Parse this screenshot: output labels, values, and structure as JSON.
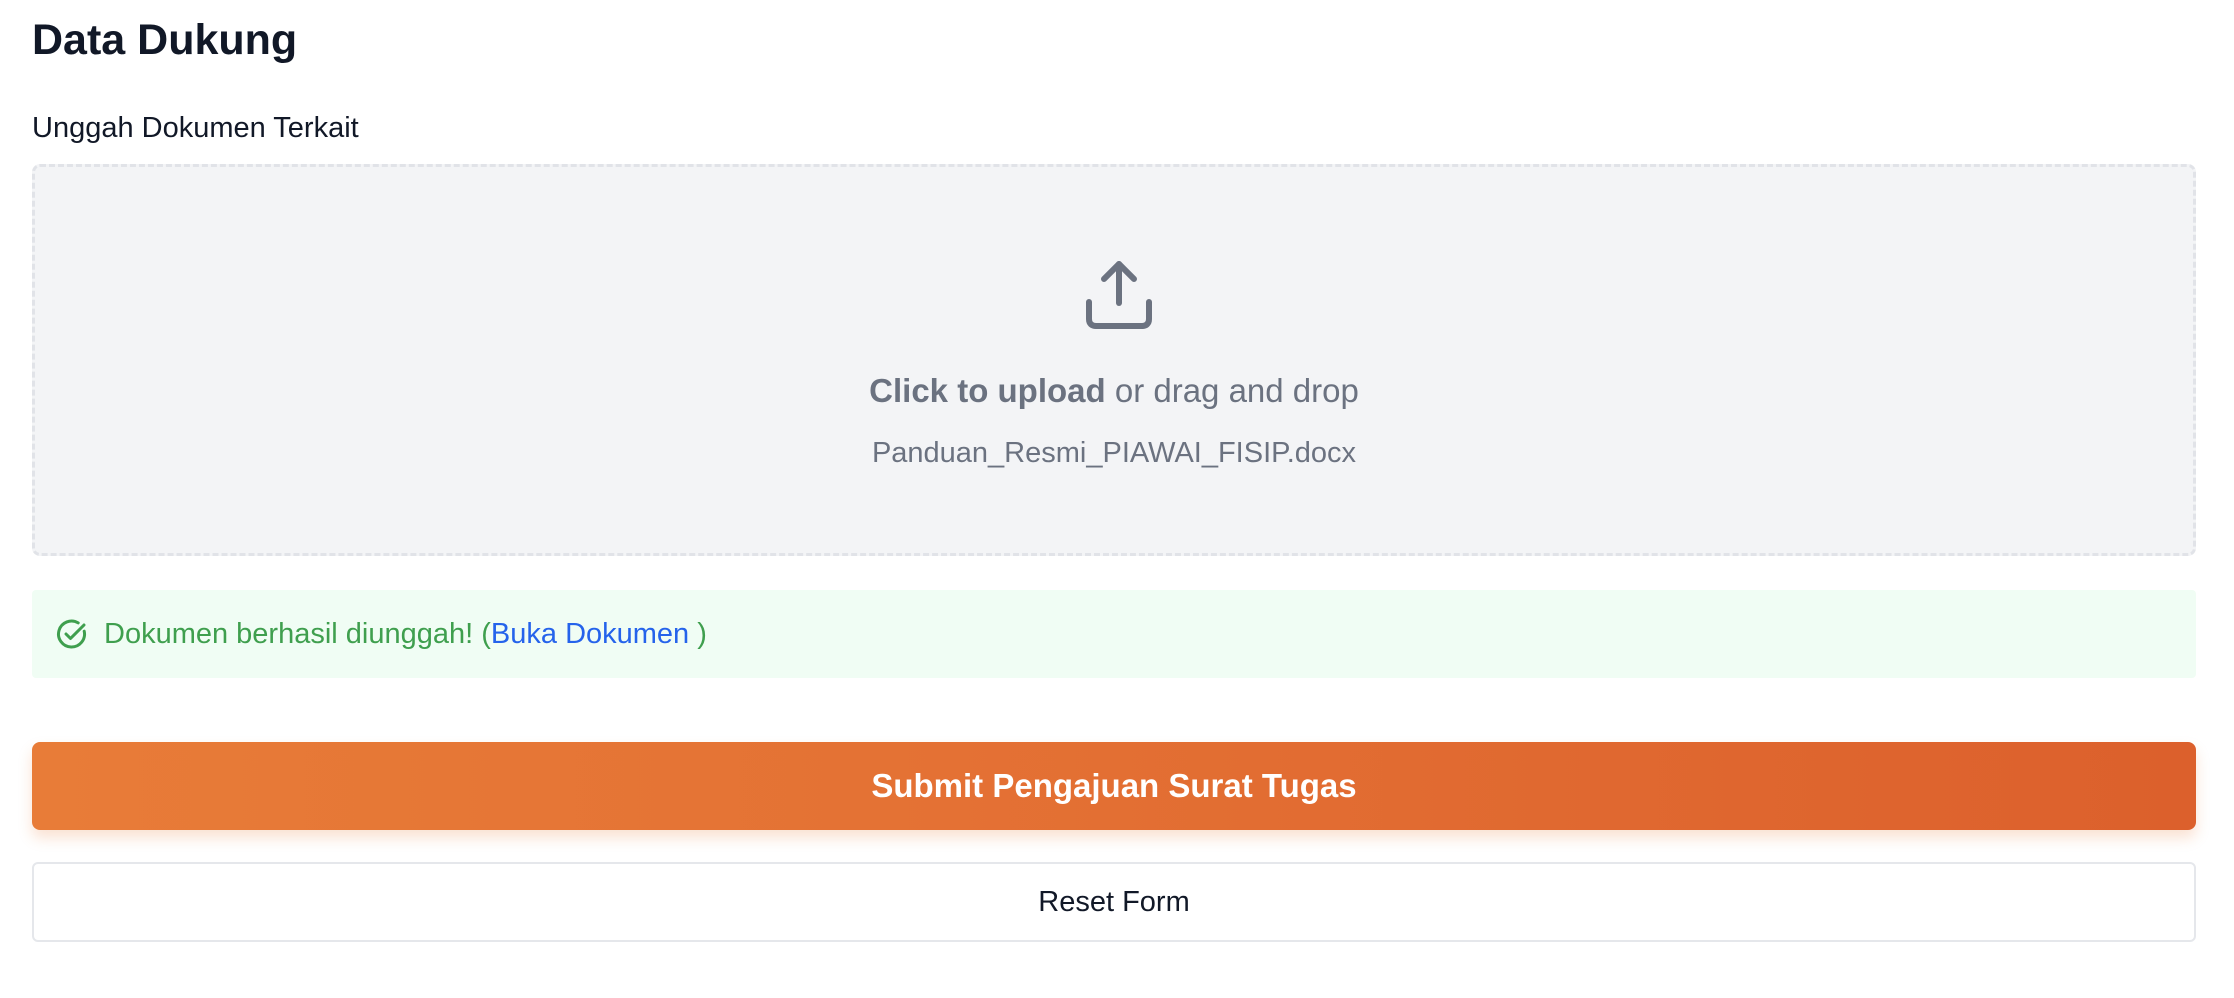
{
  "section": {
    "title": "Data Dukung"
  },
  "upload": {
    "label": "Unggah Dokumen Terkait",
    "click_text": "Click to upload",
    "drag_text": " or drag and drop",
    "file_name": "Panduan_Resmi_PIAWAI_FISIP.docx",
    "icon": "upload-icon"
  },
  "status": {
    "message": "Dokumen berhasil diunggah! (",
    "link_text": "Buka Dokumen",
    "closing": " )",
    "icon": "check-circle-icon"
  },
  "actions": {
    "submit_label": "Submit Pengajuan Surat Tugas",
    "reset_label": "Reset Form"
  },
  "colors": {
    "accent": "#e87c38",
    "success": "#3f9f4e",
    "link": "#2563eb",
    "dropzone_bg": "#f3f4f6",
    "success_bg": "#f0fdf4"
  }
}
